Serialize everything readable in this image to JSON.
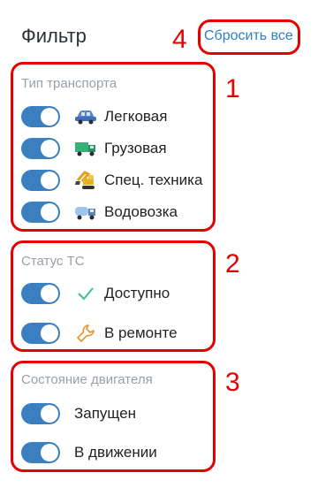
{
  "header": {
    "title": "Фильтр",
    "reset_label": "Сбросить все"
  },
  "annotations": {
    "n1": "1",
    "n2": "2",
    "n3": "3",
    "n4": "4"
  },
  "groups": [
    {
      "title": "Тип транспорта",
      "items": [
        {
          "label": "Легковая",
          "icon": "car-icon",
          "on": true
        },
        {
          "label": "Грузовая",
          "icon": "truck-icon",
          "on": true
        },
        {
          "label": "Спец. техника",
          "icon": "excavator-icon",
          "on": true
        },
        {
          "label": "Водовозка",
          "icon": "water-truck-icon",
          "on": true
        }
      ]
    },
    {
      "title": "Статус ТС",
      "items": [
        {
          "label": "Доступно",
          "icon": "check-icon",
          "on": true
        },
        {
          "label": "В ремонте",
          "icon": "wrench-icon",
          "on": true
        }
      ]
    },
    {
      "title": "Состояние двигателя",
      "items": [
        {
          "label": "Запущен",
          "on": true
        },
        {
          "label": "В движении",
          "on": true
        }
      ]
    }
  ],
  "colors": {
    "accent": "#3a7fc0",
    "annotation": "#e60000",
    "link": "#2f7fc1",
    "muted": "#9aa0a8"
  }
}
